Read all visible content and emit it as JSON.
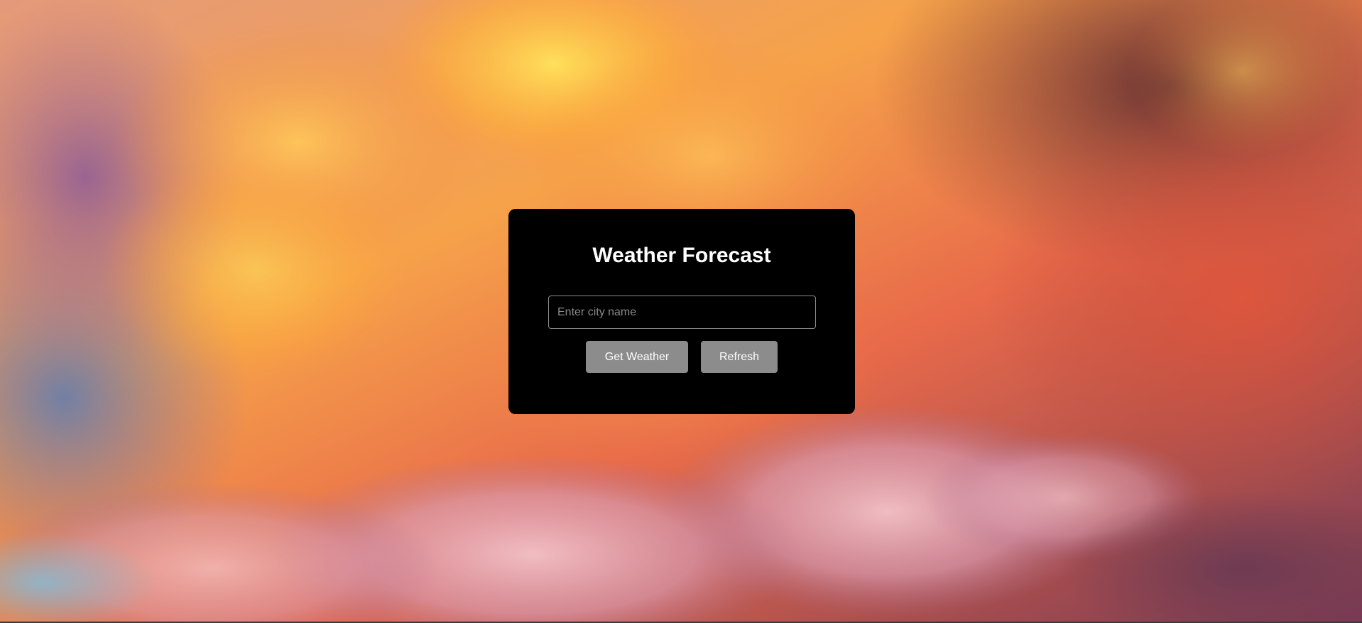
{
  "app": {
    "title": "Weather Forecast"
  },
  "search": {
    "placeholder": "Enter city name",
    "value": ""
  },
  "buttons": {
    "get_weather": "Get Weather",
    "refresh": "Refresh"
  },
  "colors": {
    "card_background": "#000000",
    "button_background": "#8c8c8c",
    "text": "#ffffff",
    "input_border": "#8c8c8c"
  },
  "background": {
    "icon": "sunset-clouds-background"
  }
}
